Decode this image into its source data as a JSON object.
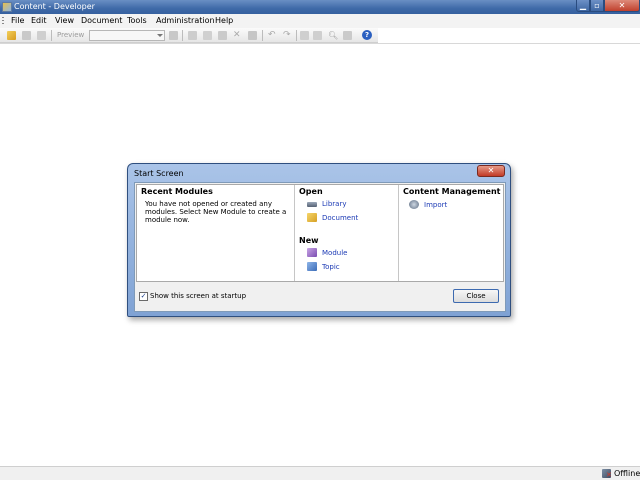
{
  "window": {
    "title": "Content - Developer"
  },
  "menu": [
    "File",
    "Edit",
    "View",
    "Document",
    "Tools",
    "Administration",
    "Help"
  ],
  "toolbar": {
    "preview_label": "Preview"
  },
  "status": {
    "connection": "Offline"
  },
  "dialog": {
    "title": "Start Screen",
    "recent": {
      "title": "Recent Modules",
      "message": "You have not opened or created any modules.  Select New Module to create a module now."
    },
    "open": {
      "title": "Open",
      "items": [
        "Library",
        "Document"
      ]
    },
    "new": {
      "title": "New",
      "items": [
        "Module",
        "Topic"
      ]
    },
    "content_management": {
      "title": "Content Management",
      "items": [
        "Import"
      ]
    },
    "show_at_startup_label": "Show this screen at startup",
    "show_at_startup_checked": true,
    "close_label": "Close"
  }
}
